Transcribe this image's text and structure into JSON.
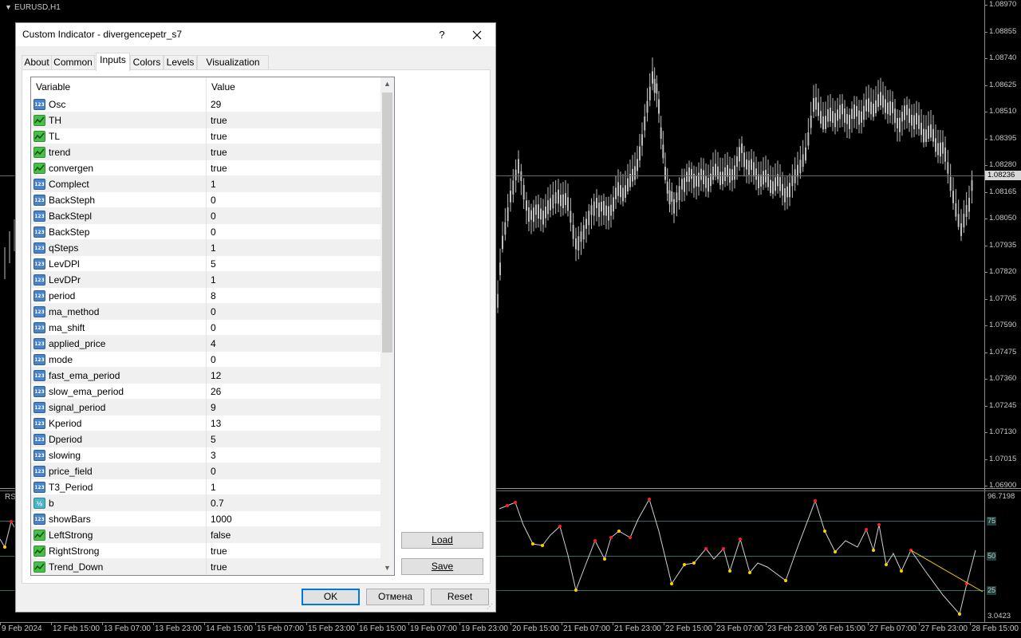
{
  "chart": {
    "symbol": "EURUSD,H1",
    "current_price": "1.08236",
    "price_labels": [
      "1.08970",
      "1.08855",
      "1.08740",
      "1.08625",
      "1.08510",
      "1.08395",
      "1.08280",
      "1.08165",
      "1.08050",
      "1.07935",
      "1.07820",
      "1.07705",
      "1.07590",
      "1.07475",
      "1.07360",
      "1.07245",
      "1.07130",
      "1.07015",
      "1.06900"
    ],
    "sub_label": "RS",
    "sub_scale": {
      "top": "96.7198",
      "bottom": "3.0423"
    },
    "levels": [
      "75",
      "50",
      "25"
    ],
    "time_labels": [
      "9 Feb 2024",
      "12 Feb 15:00",
      "13 Feb 07:00",
      "13 Feb 23:00",
      "14 Feb 15:00",
      "15 Feb 07:00",
      "15 Feb 23:00",
      "16 Feb 15:00",
      "19 Feb 07:00",
      "19 Feb 23:00",
      "20 Feb 15:00",
      "21 Feb 07:00",
      "21 Feb 23:00",
      "22 Feb 15:00",
      "23 Feb 07:00",
      "23 Feb 23:00",
      "26 Feb 15:00",
      "27 Feb 07:00",
      "27 Feb 23:00",
      "28 Feb 15:00"
    ],
    "colors": {
      "candle": "#c0c0c0",
      "level": "#2f6f68",
      "osc_line": "#d0d0d0",
      "peak_dot": "#ff2020",
      "trough_dot": "#ffd000",
      "divergence": "#ffd000"
    }
  },
  "dialog": {
    "title": "Custom Indicator - divergencepetr_s7",
    "help": "?",
    "close_icon": "close-icon",
    "tabs": [
      {
        "label": "About"
      },
      {
        "label": "Common"
      },
      {
        "label": "Inputs",
        "active": true
      },
      {
        "label": "Colors"
      },
      {
        "label": "Levels"
      },
      {
        "label": "Visualization"
      }
    ],
    "grid": {
      "col_variable": "Variable",
      "col_value": "Value",
      "rows": [
        {
          "type": "int",
          "name": "Osc",
          "value": "29"
        },
        {
          "type": "bool",
          "name": "TH",
          "value": "true"
        },
        {
          "type": "bool",
          "name": "TL",
          "value": "true"
        },
        {
          "type": "bool",
          "name": "trend",
          "value": "true"
        },
        {
          "type": "bool",
          "name": "convergen",
          "value": "true"
        },
        {
          "type": "int",
          "name": "Complect",
          "value": "1"
        },
        {
          "type": "int",
          "name": "BackSteph",
          "value": "0"
        },
        {
          "type": "int",
          "name": "BackStepl",
          "value": "0"
        },
        {
          "type": "int",
          "name": "BackStep",
          "value": "0"
        },
        {
          "type": "int",
          "name": "qSteps",
          "value": "1"
        },
        {
          "type": "int",
          "name": "LevDPl",
          "value": "5"
        },
        {
          "type": "int",
          "name": "LevDPr",
          "value": "1"
        },
        {
          "type": "int",
          "name": "period",
          "value": "8"
        },
        {
          "type": "int",
          "name": "ma_method",
          "value": "0"
        },
        {
          "type": "int",
          "name": "ma_shift",
          "value": "0"
        },
        {
          "type": "int",
          "name": "applied_price",
          "value": "4"
        },
        {
          "type": "int",
          "name": "mode",
          "value": "0"
        },
        {
          "type": "int",
          "name": "fast_ema_period",
          "value": "12"
        },
        {
          "type": "int",
          "name": "slow_ema_period",
          "value": "26"
        },
        {
          "type": "int",
          "name": "signal_period",
          "value": "9"
        },
        {
          "type": "int",
          "name": "Kperiod",
          "value": "13"
        },
        {
          "type": "int",
          "name": "Dperiod",
          "value": "5"
        },
        {
          "type": "int",
          "name": "slowing",
          "value": "3"
        },
        {
          "type": "int",
          "name": "price_field",
          "value": "0"
        },
        {
          "type": "int",
          "name": "T3_Period",
          "value": "1"
        },
        {
          "type": "double",
          "name": "b",
          "value": "0.7"
        },
        {
          "type": "int",
          "name": "showBars",
          "value": "1000"
        },
        {
          "type": "bool",
          "name": "LeftStrong",
          "value": "false"
        },
        {
          "type": "bool",
          "name": "RightStrong",
          "value": "true"
        },
        {
          "type": "bool",
          "name": "Trend_Down",
          "value": "true"
        }
      ]
    },
    "icon_glyphs": {
      "int": "123",
      "bool": "",
      "double": "½"
    },
    "load_button": "Load",
    "save_button": "Save",
    "ok_button": "OK",
    "cancel_button": "Отмена",
    "reset_button": "Reset"
  }
}
